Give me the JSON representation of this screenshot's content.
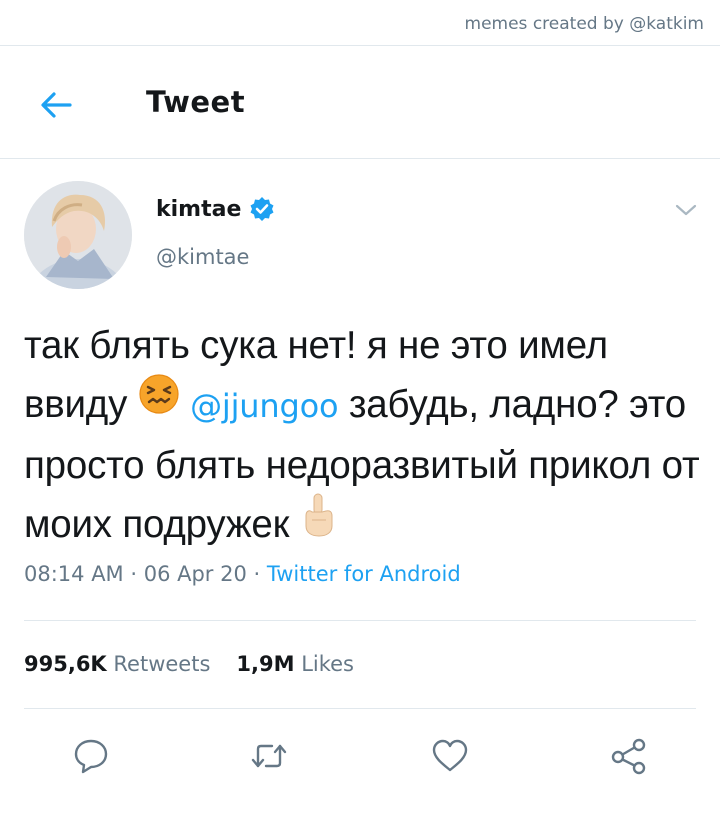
{
  "credit": "memes created by @katkim",
  "header": {
    "title": "Tweet"
  },
  "author": {
    "name": "kimtae",
    "handle": "@kimtae",
    "verified": true
  },
  "tweet": {
    "text_part1": "так блять сука нет! я не это имел ввиду ",
    "mention": "@jjungoo",
    "text_part2": " забудь, ладно? это просто блять недоразвитый прикол от моих подружек ",
    "emoji_1": "confounded-face",
    "emoji_2": "middle-finger"
  },
  "meta": {
    "time": "08:14 AM",
    "separator": " · ",
    "date": "06 Apr 20",
    "source": "Twitter for Android"
  },
  "stats": {
    "retweets_count": "995,6K",
    "retweets_label": "Retweets",
    "likes_count": "1,9M",
    "likes_label": "Likes"
  },
  "icons": [
    "back-arrow-icon",
    "verified-icon",
    "chevron-down-icon",
    "reply-icon",
    "retweet-icon",
    "like-icon",
    "share-icon"
  ],
  "colors": {
    "accent": "#1da1f2",
    "text": "#14171a",
    "secondary": "#657786",
    "border": "#e1e8ed"
  }
}
